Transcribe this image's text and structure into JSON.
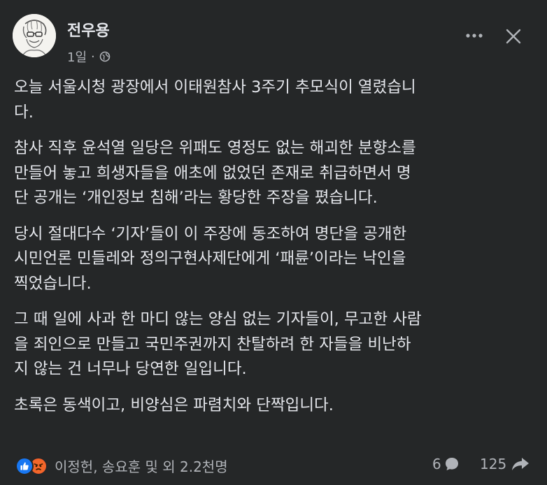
{
  "post": {
    "author": "전우용",
    "time": "1일",
    "separator": "·",
    "privacy_icon": "globe-icon",
    "avatar_icon": "avatar-sketch-icon"
  },
  "actions": {
    "more_icon": "more-horizontal-icon",
    "close_icon": "close-icon"
  },
  "paragraphs": [
    {
      "lines": [
        "오늘 서울시청 광장에서 이태원참사 3주기 추모식이 열렸습니",
        "다."
      ]
    },
    {
      "lines": [
        "참사 직후 윤석열 일당은 위패도 영정도 없는 해괴한 분향소를",
        "만들어 놓고 희생자들을 애초에 없었던 존재로 취급하면서 명",
        "단 공개는 ‘개인정보 침해’라는 황당한 주장을 폈습니다."
      ]
    },
    {
      "lines": [
        "당시 절대다수 ‘기자’들이 이 주장에 동조하여 명단을 공개한",
        "시민언론 민들레와 정의구현사제단에게 ‘패륜’이라는 낙인을",
        "찍었습니다."
      ]
    },
    {
      "lines": [
        "그 때 일에 사과 한 마디 않는 양심 없는 기자들이, 무고한 사람",
        "을 죄인으로 만들고 국민주권까지 찬탈하려 한 자들을 비난하",
        "지 않는 건 너무나 당연한 일입니다."
      ]
    },
    {
      "lines": [
        "초록은 동색이고, 비양심은 파렴치와 단짝입니다."
      ]
    }
  ],
  "footer": {
    "reaction_icons": [
      "like-icon",
      "angry-icon"
    ],
    "reactions_text": "이정헌, 송요훈 및 외 2.2천명",
    "comment_count": "6",
    "comment_icon": "comment-icon",
    "share_count": "125",
    "share_icon": "share-icon"
  },
  "colors": {
    "background": "#252728",
    "text_primary": "#e4e6eb",
    "text_secondary": "#b0b3b8",
    "like_blue": "#1877f2",
    "angry_orange": "#f25c2a"
  }
}
